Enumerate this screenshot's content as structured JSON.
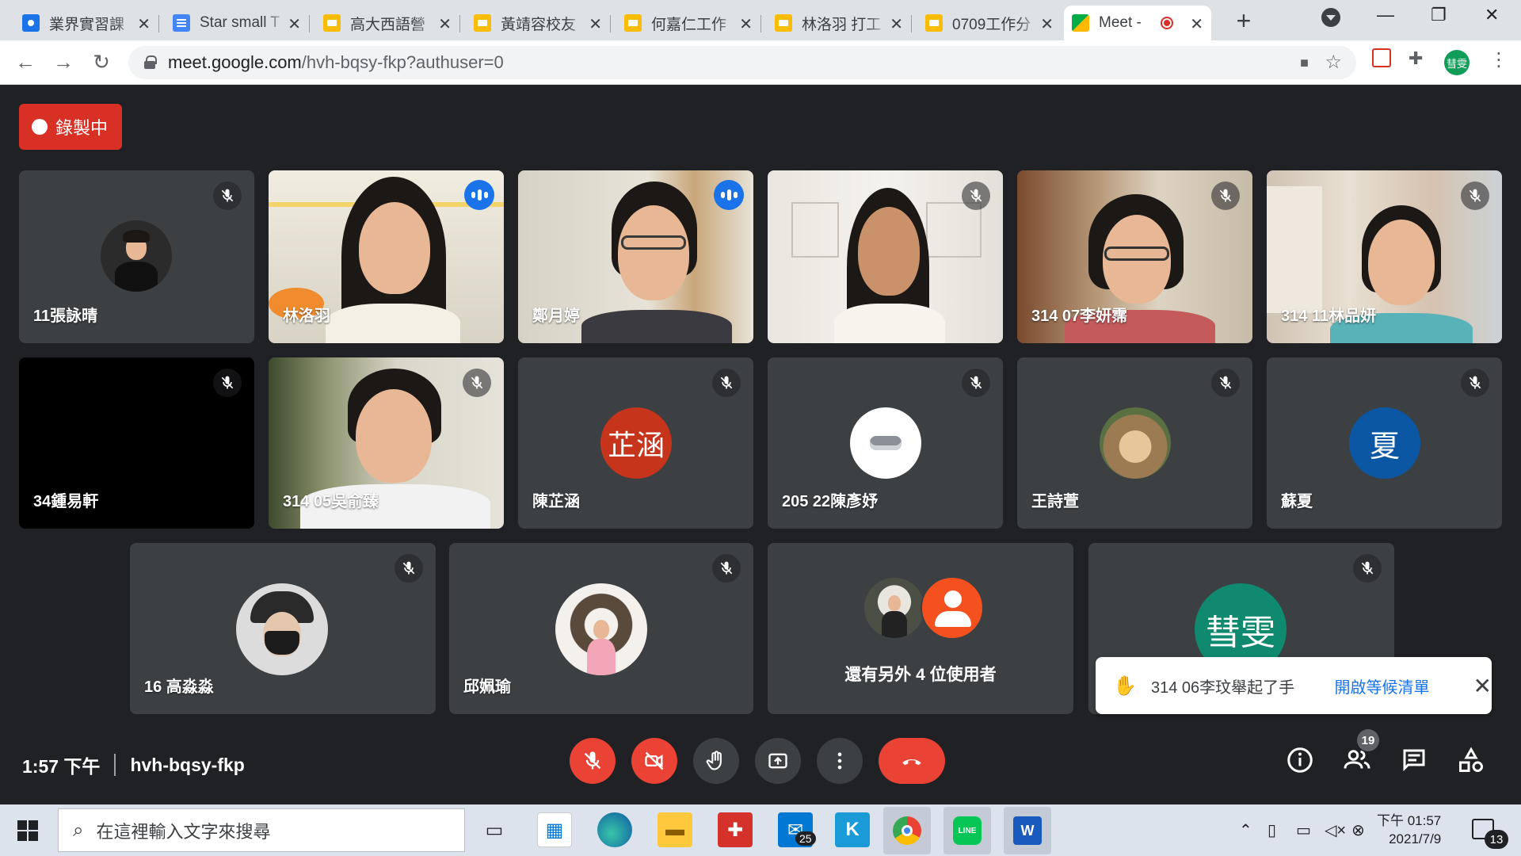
{
  "browser": {
    "tabs": [
      {
        "title": "業界實習課",
        "icon": "contacts-icon"
      },
      {
        "title": "Star small T",
        "icon": "docs-icon"
      },
      {
        "title": "高大西語營",
        "icon": "slides-icon"
      },
      {
        "title": "黃靖容校友",
        "icon": "slides-icon"
      },
      {
        "title": "何嘉仁工作",
        "icon": "slides-icon"
      },
      {
        "title": "林洛羽 打工",
        "icon": "slides-icon"
      },
      {
        "title": "0709工作分",
        "icon": "slides-icon"
      },
      {
        "title": "Meet -",
        "icon": "meet-icon"
      }
    ],
    "url_host": "meet.google.com",
    "url_path": "/hvh-bqsy-fkp?authuser=0",
    "profile_initials": "彗雯"
  },
  "recording": {
    "label": "錄製中"
  },
  "participants": [
    {
      "name": "11張詠晴",
      "muted": true
    },
    {
      "name": "林洛羽",
      "muted": false,
      "speaking": true
    },
    {
      "name": "鄭月婷",
      "muted": false,
      "speaking": true
    },
    {
      "name": "",
      "muted": true
    },
    {
      "name": "314 07李妍霈",
      "muted": true
    },
    {
      "name": "314 11林品妍",
      "muted": true
    },
    {
      "name": "34鍾易軒",
      "muted": true
    },
    {
      "name": "314 05吳俞臻",
      "muted": true
    },
    {
      "name": "陳芷涵",
      "muted": true,
      "initials": "芷涵",
      "color": "#c5341b"
    },
    {
      "name": "205 22陳彥妤",
      "muted": true
    },
    {
      "name": "王詩萱",
      "muted": true
    },
    {
      "name": "蘇夏",
      "muted": true,
      "initials": "夏",
      "color": "#0b57a4"
    },
    {
      "name": "16 高淼淼",
      "muted": true
    },
    {
      "name": "邱姵瑜",
      "muted": true
    },
    {
      "name": "還有另外 4 位使用者"
    },
    {
      "name": "",
      "muted": true,
      "initials": "彗雯",
      "color": "#0f8a6e"
    }
  ],
  "toast": {
    "message": "314 06李玟舉起了手",
    "action": "開啟等候清單"
  },
  "meeting": {
    "time": "1:57 下午",
    "code": "hvh-bqsy-fkp",
    "participant_count": "19"
  },
  "taskbar": {
    "search_placeholder": "在這裡輸入文字來搜尋",
    "mail_badge": "25",
    "time": "下午 01:57",
    "date": "2021/7/9",
    "notifications": "13"
  },
  "colors": {
    "meet_bg": "#202124",
    "tile_bg": "#3c4043",
    "danger": "#ea4335",
    "accent": "#1a73e8"
  }
}
